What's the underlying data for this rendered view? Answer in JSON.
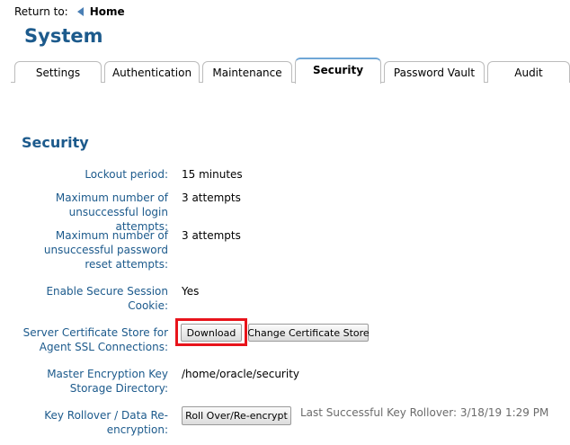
{
  "return_bar": {
    "label": "Return to:",
    "link": "Home"
  },
  "page_title": "System",
  "tabs": [
    {
      "label": "Settings",
      "active": false
    },
    {
      "label": "Authentication",
      "active": false
    },
    {
      "label": "Maintenance",
      "active": false
    },
    {
      "label": "Security",
      "active": true
    },
    {
      "label": "Password Vault",
      "active": false
    },
    {
      "label": "Audit",
      "active": false
    }
  ],
  "section_title": "Security",
  "fields": {
    "lockout": {
      "label": "Lockout period:",
      "value": "15 minutes"
    },
    "login_attempts": {
      "label_1": "Maximum number of",
      "label_2": "unsuccessful login attempts:",
      "value": "3 attempts"
    },
    "reset_attempts": {
      "label_1": "Maximum number of",
      "label_2": "unsuccessful password",
      "label_3": "reset attempts:",
      "value": "3 attempts"
    },
    "secure_cookie": {
      "label_1": "Enable Secure Session",
      "label_2": "Cookie:",
      "value": "Yes"
    },
    "cert_store": {
      "label_1": "Server Certificate Store for",
      "label_2": "Agent SSL Connections:",
      "download_button": "Download",
      "change_button": "Change Certificate Store"
    },
    "encryption_dir": {
      "label_1": "Master Encryption Key",
      "label_2": "Storage Directory:",
      "value": "/home/oracle/security"
    },
    "key_rollover": {
      "label_1": "Key Rollover / Data Re-",
      "label_2": "encryption:",
      "button": "Roll Over/Re-encrypt",
      "last_rollover": "Last Successful Key Rollover: 3/18/19 1:29 PM"
    }
  },
  "colors": {
    "accent": "#1c5a8c",
    "highlight": "#e8141b",
    "tab_active_border": "#6fa6d6"
  },
  "icons": {
    "return": "left-triangle-icon"
  }
}
